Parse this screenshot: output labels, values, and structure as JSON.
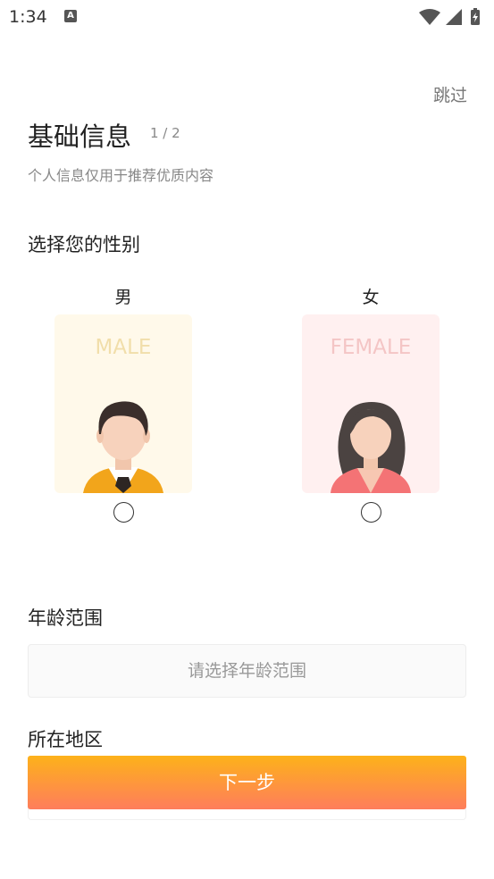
{
  "status_bar": {
    "time": "1:34",
    "notification_icon_letter": "A"
  },
  "header": {
    "skip_label": "跳过",
    "title": "基础信息",
    "step": "1 / 2",
    "subtitle": "个人信息仅用于推荐优质内容"
  },
  "gender": {
    "label": "选择您的性别",
    "options": [
      {
        "name": "男",
        "caption": "MALE",
        "selected": false
      },
      {
        "name": "女",
        "caption": "FEMALE",
        "selected": false
      }
    ]
  },
  "age": {
    "label": "年龄范围",
    "placeholder": "请选择年龄范围"
  },
  "region": {
    "label": "所在地区"
  },
  "next_button": {
    "label": "下一步"
  },
  "colors": {
    "accent_top": "#fdb21a",
    "accent_bottom": "#fe7d5c",
    "male_card_bg": "#fff9ea",
    "female_card_bg": "#fff0f0"
  }
}
